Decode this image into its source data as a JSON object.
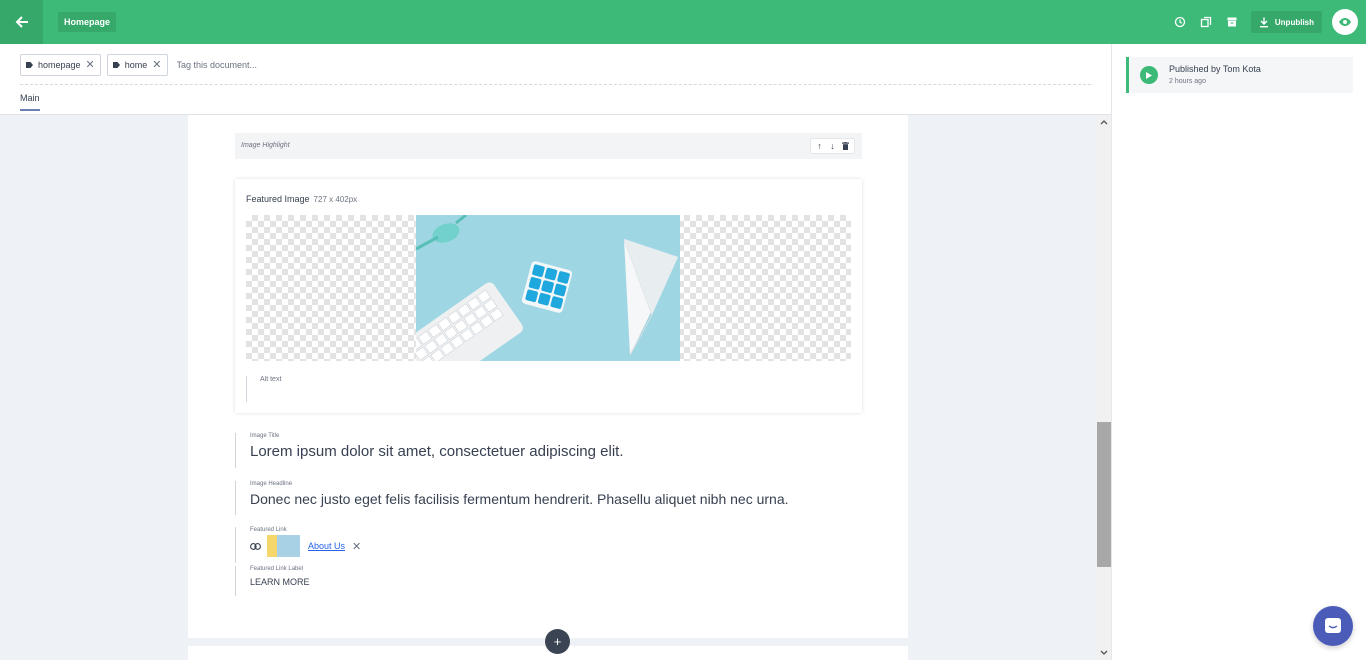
{
  "header": {
    "page_name": "Homepage",
    "unpublish_label": "Unpublish",
    "icons": [
      "arrow-left-icon",
      "history-icon",
      "duplicate-icon",
      "archive-icon",
      "download-icon",
      "eye-icon"
    ]
  },
  "tags": {
    "items": [
      {
        "label": "homepage"
      },
      {
        "label": "home"
      }
    ],
    "placeholder": "Tag this document..."
  },
  "tabs": {
    "main_label": "Main"
  },
  "block": {
    "label": "Image Highlight",
    "featured_image_label": "Featured Image",
    "featured_image_dims": "727 x 402px",
    "alt_placeholder": "Alt text",
    "image_title_label": "Image Title",
    "image_title": "Lorem ipsum dolor sit amet, consectetuer adipiscing elit.",
    "image_headline_label": "Image Headline",
    "image_headline": "Donec nec justo eget felis facilisis fermentum hendrerit. Phasellu aliquet nibh nec urna.",
    "featured_link_label": "Featured Link",
    "featured_link_text": "About Us",
    "featured_link_label_label": "Featured Link Label",
    "featured_link_label_value": "LEARN MORE"
  },
  "sidebar": {
    "published_text": "Published by Tom Kota",
    "published_time": "2 hours ago"
  },
  "colors": {
    "accent": "#3dba77",
    "accent_dark": "#35a86a",
    "chat": "#4a5cb8"
  }
}
